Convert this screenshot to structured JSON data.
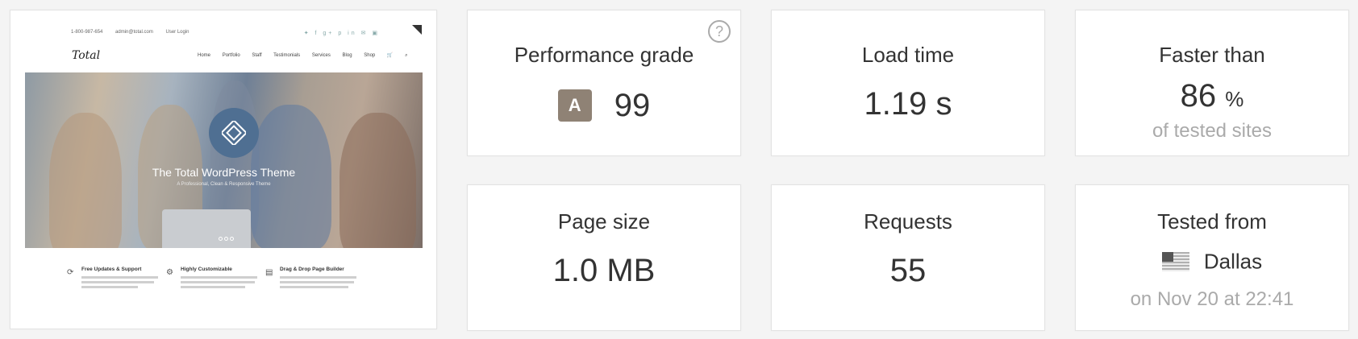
{
  "screenshot": {
    "topbar": [
      "1-800-987-654",
      "admin@total.com",
      "User Login"
    ],
    "social_icons": [
      "twitter-icon",
      "facebook-icon",
      "google-plus-icon",
      "pinterest-icon",
      "linkedin-icon",
      "rss-icon",
      "email-icon"
    ],
    "logo": "Total",
    "nav": [
      "Home",
      "Portfolio",
      "Staff",
      "Testimonials",
      "Services",
      "Blog",
      "Shop"
    ],
    "hero_title": "The Total WordPress Theme",
    "hero_subtitle": "A Professional, Clean & Responsive Theme",
    "features": [
      {
        "icon": "refresh-icon",
        "title": "Free Updates & Support"
      },
      {
        "icon": "gears-icon",
        "title": "Highly Customizable"
      },
      {
        "icon": "document-icon",
        "title": "Drag & Drop Page Builder"
      }
    ]
  },
  "metrics": {
    "performance": {
      "label": "Performance grade",
      "grade": "A",
      "score": "99",
      "help": "?"
    },
    "load_time": {
      "label": "Load time",
      "value": "1.19 s"
    },
    "faster_than": {
      "label": "Faster than",
      "value": "86",
      "unit": "%",
      "sub": "of tested sites"
    },
    "page_size": {
      "label": "Page size",
      "value": "1.0 MB"
    },
    "requests": {
      "label": "Requests",
      "value": "55"
    },
    "tested_from": {
      "label": "Tested from",
      "location": "Dallas",
      "flag": "us-flag-icon",
      "date": "on Nov 20 at 22:41"
    }
  },
  "colors": {
    "grade_badge": "#8f8275",
    "sub_text": "#aaaaaa",
    "background": "#f4f4f4"
  }
}
